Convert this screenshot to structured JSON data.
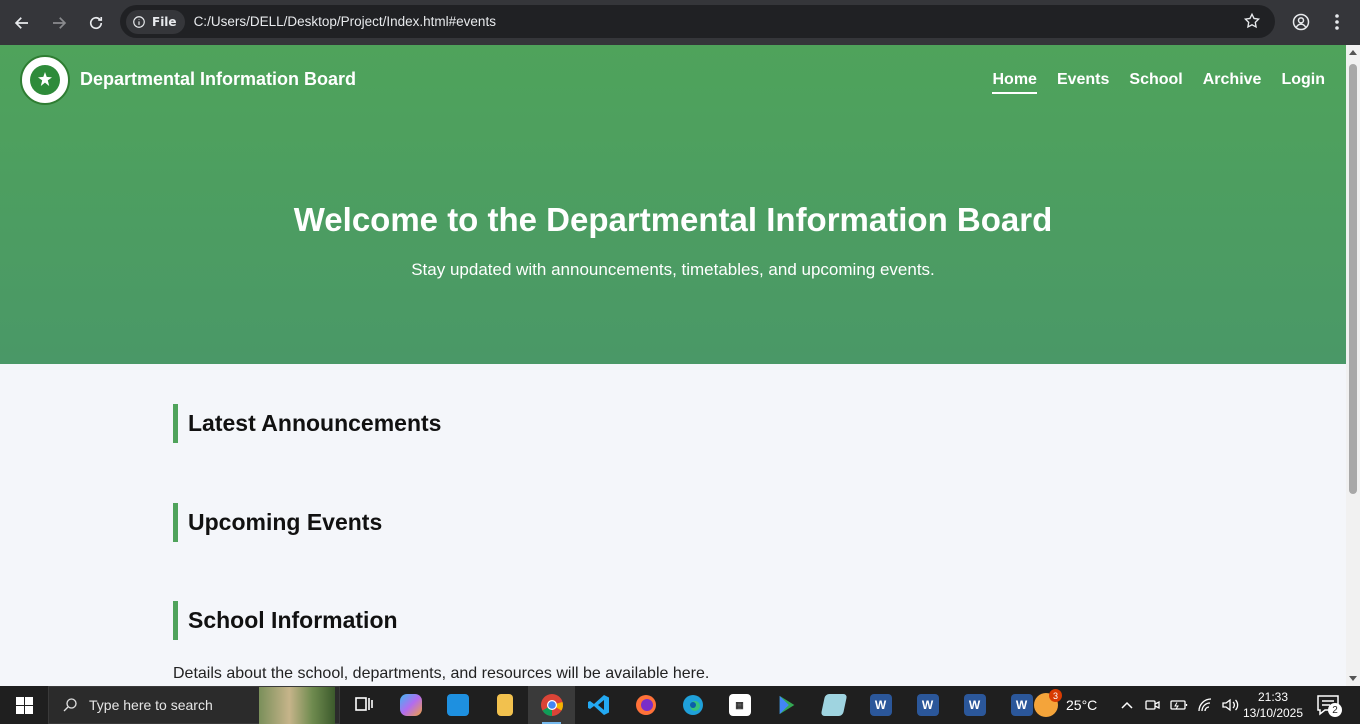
{
  "browser": {
    "site_chip_label": "File",
    "url": "C:/Users/DELL/Desktop/Project/Index.html#events"
  },
  "site": {
    "brand": "Departmental Information Board",
    "nav": [
      "Home",
      "Events",
      "School",
      "Archive",
      "Login"
    ],
    "active_nav": "Home",
    "hero_title": "Welcome to the Departmental Information Board",
    "hero_subtitle": "Stay updated with announcements, timetables, and upcoming events.",
    "sections": [
      {
        "heading": "Latest Announcements",
        "body": ""
      },
      {
        "heading": "Upcoming Events",
        "body": ""
      },
      {
        "heading": "School Information",
        "body": "Details about the school, departments, and resources will be available here."
      }
    ],
    "colors": {
      "hero": "#4fa35b",
      "accent": "#4fa35b",
      "page_bg": "#f4f6fa"
    }
  },
  "taskbar": {
    "search_placeholder": "Type here to search",
    "weather_badge": "3",
    "weather_temp": "25°C",
    "time": "21:33",
    "date": "13/10/2025",
    "notification_count": "2",
    "apps": [
      "task-view",
      "copilot",
      "mail",
      "file-explorer",
      "chrome",
      "vscode",
      "firefox",
      "edge",
      "calendar-app",
      "play-store",
      "notepad",
      "word",
      "word",
      "word",
      "word"
    ]
  }
}
